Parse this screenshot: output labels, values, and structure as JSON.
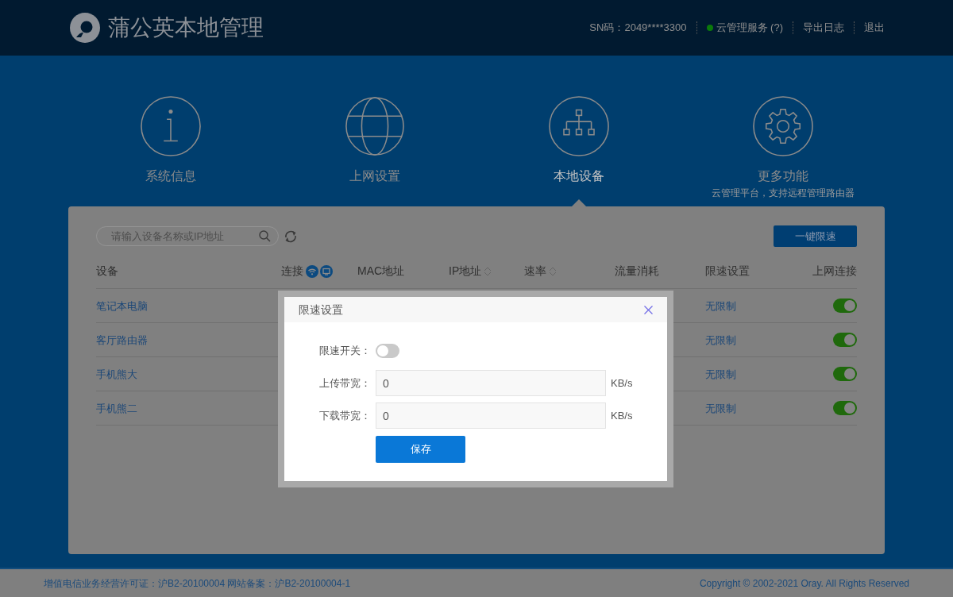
{
  "header": {
    "title": "蒲公英本地管理",
    "sn": "SN码：2049****3300",
    "cloud_service": {
      "label": "云管理服务 (?)",
      "online": true
    },
    "links": [
      "导出日志",
      "退出"
    ]
  },
  "nav": [
    {
      "label": "系统信息",
      "kind": "info",
      "selected": false
    },
    {
      "label": "上网设置",
      "kind": "globe",
      "selected": false
    },
    {
      "label": "本地设备",
      "kind": "network",
      "selected": true
    },
    {
      "label": "更多功能",
      "kind": "gear",
      "selected": false,
      "subtitle": "云管理平台，支持远程管理路由器"
    }
  ],
  "toolbar": {
    "search": {
      "placeholder": "请输入设备名称或IP地址"
    },
    "limit_all_button": "一键限速"
  },
  "table": {
    "columns": [
      {
        "label": "设备",
        "kind": "plain"
      },
      {
        "label": "连接",
        "kind": "connection"
      },
      {
        "label": "MAC地址",
        "kind": "plain"
      },
      {
        "label": "IP地址",
        "kind": "sortable"
      },
      {
        "label": "速率",
        "kind": "sortable"
      },
      {
        "label": "流量消耗",
        "kind": "plain"
      },
      {
        "label": "限速设置",
        "kind": "plain"
      },
      {
        "label": "上网连接",
        "kind": "plain"
      }
    ],
    "rows": [
      {
        "device": "笔记本电脑",
        "limit": "无限制",
        "internet_on": true
      },
      {
        "device": "客厅路由器",
        "limit": "无限制",
        "internet_on": true
      },
      {
        "device": "手机熊大",
        "limit": "无限制",
        "internet_on": true
      },
      {
        "device": "手机熊二",
        "limit": "无限制",
        "internet_on": true
      }
    ]
  },
  "modal": {
    "title": "限速设置",
    "switch": {
      "label": "限速开关：",
      "on": false
    },
    "fields": [
      {
        "label": "上传带宽：",
        "value": "0",
        "unit": "KB/s"
      },
      {
        "label": "下载带宽：",
        "value": "0",
        "unit": "KB/s"
      }
    ],
    "save_button": "保存"
  },
  "footer": {
    "license": "增值电信业务经营许可证：沪B2-20100004 网站备案：沪B2-20100004-1",
    "copyright": "Copyright © 2002-2021 Oray. All Rights Reserved"
  }
}
